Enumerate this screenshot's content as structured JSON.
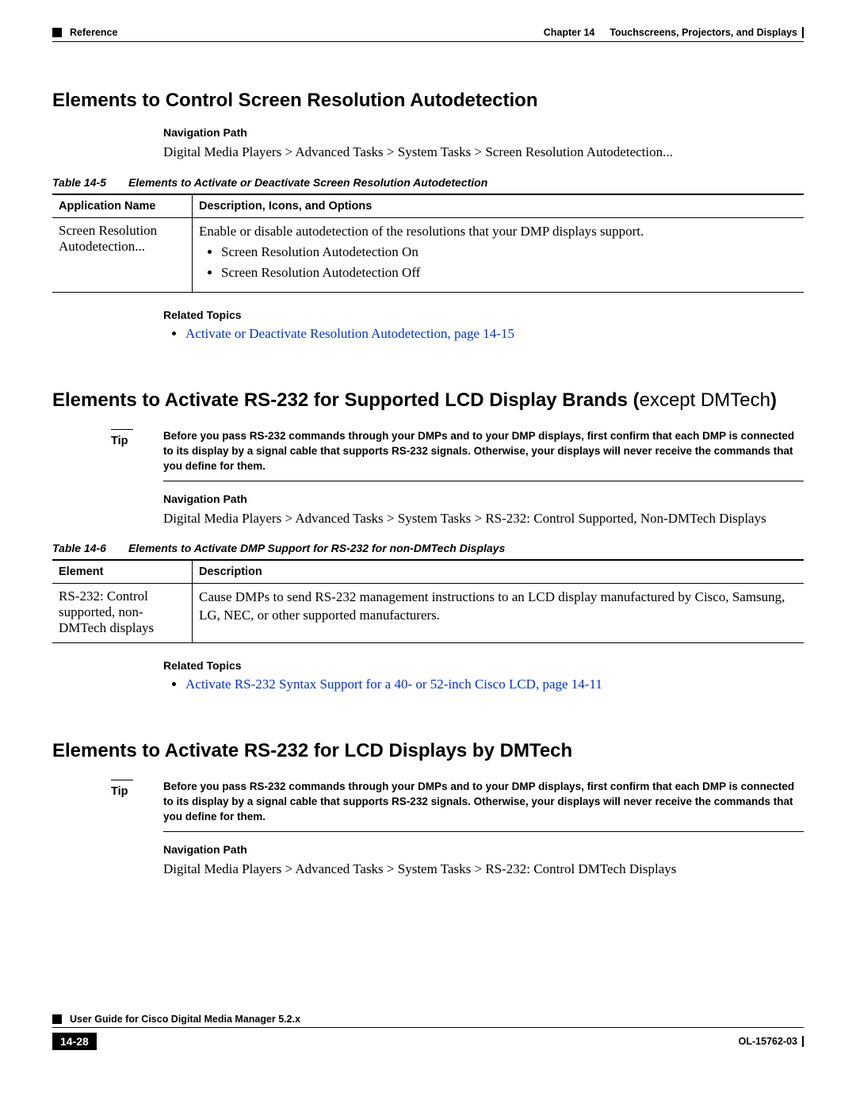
{
  "header": {
    "left": "Reference",
    "chapter_label": "Chapter 14",
    "chapter_title": "Touchscreens, Projectors, and Displays"
  },
  "section1": {
    "title": "Elements to Control Screen Resolution Autodetection",
    "nav_label": "Navigation Path",
    "nav_path": "Digital Media Players > Advanced Tasks > System Tasks > Screen Resolution Autodetection...",
    "table_num": "Table 14-5",
    "table_title": "Elements to Activate or Deactivate Screen Resolution Autodetection",
    "th1": "Application Name",
    "th2": "Description, Icons, and Options",
    "row_app": "Screen Resolution Autodetection...",
    "row_desc": "Enable or disable autodetection of the resolutions that your DMP displays support.",
    "row_b1": "Screen Resolution Autodetection On",
    "row_b2": "Screen Resolution Autodetection Off",
    "related_label": "Related Topics",
    "related_link": "Activate or Deactivate Resolution Autodetection, page 14-15"
  },
  "section2": {
    "title_bold": "Elements to Activate RS-232 for Supported LCD Display Brands (",
    "title_light": "except DMTech",
    "title_close": ")",
    "tip_label": "Tip",
    "tip_text": "Before you pass RS-232 commands through your DMPs and to your DMP displays, first confirm that each DMP is connected to its display by a signal cable that supports RS-232 signals. Otherwise, your displays will never receive the commands that you define for them.",
    "nav_label": "Navigation Path",
    "nav_path": "Digital Media Players > Advanced Tasks > System Tasks > RS-232: Control Supported, Non-DMTech Displays",
    "table_num": "Table 14-6",
    "table_title": "Elements to Activate DMP Support for RS-232 for non-DMTech Displays",
    "th1": "Element",
    "th2": "Description",
    "row_el": "RS-232: Control supported, non-DMTech displays",
    "row_desc": "Cause DMPs to send RS-232 management instructions to an LCD display manufactured by Cisco, Samsung, LG, NEC, or other supported manufacturers.",
    "related_label": "Related Topics",
    "related_link": "Activate RS-232 Syntax Support for a 40- or 52-inch Cisco LCD, page 14-11"
  },
  "section3": {
    "title": "Elements to Activate RS-232 for LCD Displays by DMTech",
    "tip_label": "Tip",
    "tip_text": "Before you pass RS-232 commands through your DMPs and to your DMP displays, first confirm that each DMP is connected to its display by a signal cable that supports RS-232 signals. Otherwise, your displays will never receive the commands that you define for them.",
    "nav_label": "Navigation Path",
    "nav_path": "Digital Media Players > Advanced Tasks > System Tasks > RS-232: Control DMTech Displays"
  },
  "footer": {
    "guide": "User Guide for Cisco Digital Media Manager 5.2.x",
    "page": "14-28",
    "docid": "OL-15762-03"
  }
}
